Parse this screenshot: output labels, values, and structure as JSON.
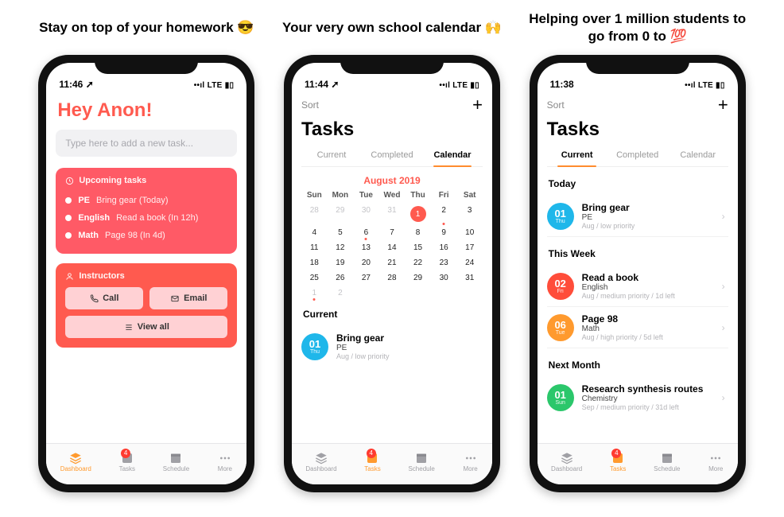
{
  "slides": {
    "s1": {
      "title": "Stay on top of your homework 😎"
    },
    "s2": {
      "title": "Your very own school calendar 🙌"
    },
    "s3": {
      "title": "Helping over 1 million students to go from 0 to 💯"
    }
  },
  "status": {
    "s1_time": "11:46 ➚",
    "s2_time": "11:44 ➚",
    "s3_time": "11:38",
    "signal": "••ıl LTE ▮▯"
  },
  "screen1": {
    "greeting": "Hey Anon!",
    "placeholder": "Type here to add a new task...",
    "upcoming_header": "Upcoming tasks",
    "instructors_header": "Instructors",
    "tasks": [
      {
        "subj": "PE",
        "desc": "Bring gear (Today)"
      },
      {
        "subj": "English",
        "desc": "Read a book (In 12h)"
      },
      {
        "subj": "Math",
        "desc": "Page 98 (In 4d)"
      }
    ],
    "call": "Call",
    "email": "Email",
    "viewall": "View all"
  },
  "tasks_page": {
    "sort": "Sort",
    "title": "Tasks",
    "tab_current": "Current",
    "tab_completed": "Completed",
    "tab_calendar": "Calendar"
  },
  "calendar": {
    "month": "August 2019",
    "dows": [
      "Sun",
      "Mon",
      "Tue",
      "Wed",
      "Thu",
      "Fri",
      "Sat"
    ],
    "current_header": "Current",
    "item1_day": "01",
    "item1_dow": "Thu",
    "item1_title": "Bring gear",
    "item1_sub": "PE",
    "item1_meta": "Aug / low priority"
  },
  "tasklist": {
    "sec1": "Today",
    "sec2": "This Week",
    "sec3": "Next Month",
    "items": {
      "a": {
        "day": "01",
        "dow": "Thu",
        "title": "Bring gear",
        "sub": "PE",
        "meta": "Aug / low priority"
      },
      "b": {
        "day": "02",
        "dow": "Fri",
        "title": "Read a book",
        "sub": "English",
        "meta": "Aug / medium priority / 1d left"
      },
      "c": {
        "day": "06",
        "dow": "Tue",
        "title": "Page 98",
        "sub": "Math",
        "meta": "Aug / high priority / 5d left"
      },
      "d": {
        "day": "01",
        "dow": "Sun",
        "title": "Research synthesis routes",
        "sub": "Chemistry",
        "meta": "Sep / medium priority / 31d left"
      }
    }
  },
  "tabbar": {
    "dashboard": "Dashboard",
    "tasks": "Tasks",
    "schedule": "Schedule",
    "more": "More",
    "badge": "4"
  }
}
